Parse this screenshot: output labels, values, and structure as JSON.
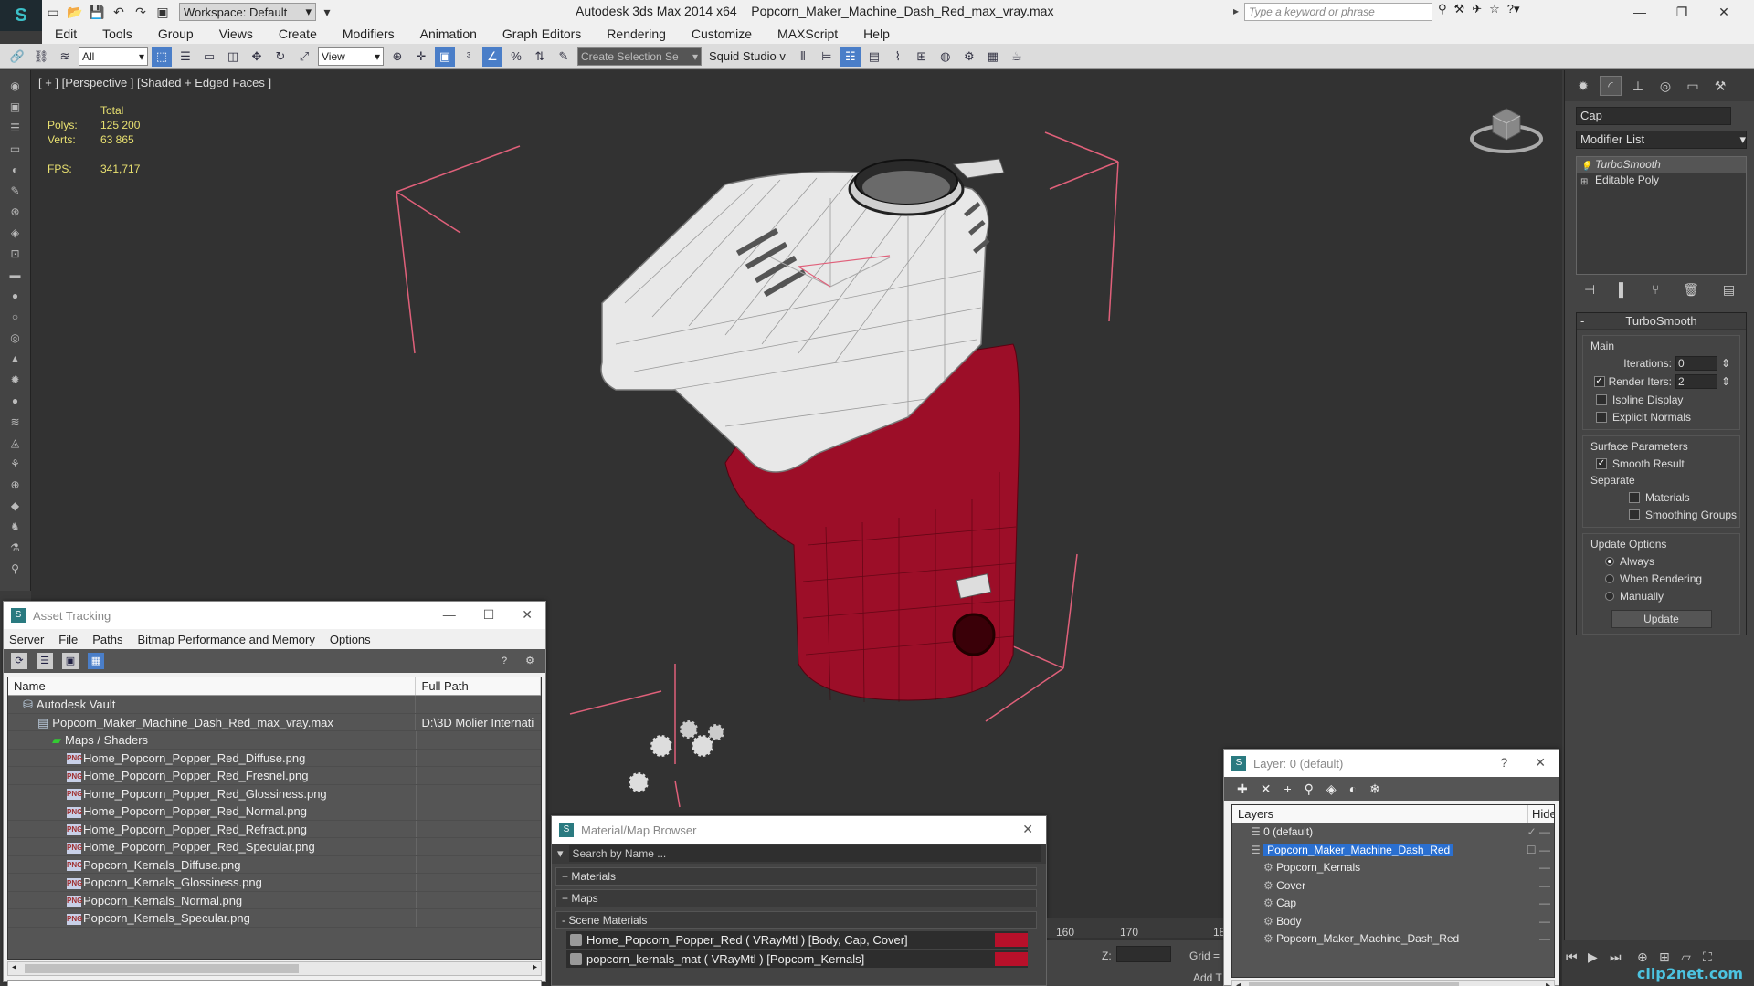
{
  "app": {
    "title": "Autodesk 3ds Max  2014 x64",
    "file": "Popcorn_Maker_Machine_Dash_Red_max_vray.max",
    "workspace": "Workspace: Default",
    "search_placeholder": "Type a keyword or phrase"
  },
  "menu": [
    "Edit",
    "Tools",
    "Group",
    "Views",
    "Create",
    "Modifiers",
    "Animation",
    "Graph Editors",
    "Rendering",
    "Customize",
    "MAXScript",
    "Help"
  ],
  "toolbar": {
    "filter": "All",
    "ref_coord": "View",
    "selection_set_placeholder": "Create Selection Se",
    "squid": "Squid Studio v"
  },
  "viewport": {
    "label": "[ + ] [Perspective ] [Shaded + Edged Faces ]",
    "stats_header": "Total",
    "polys_label": "Polys:",
    "polys_value": "125 200",
    "verts_label": "Verts:",
    "verts_value": "63 865",
    "fps_label": "FPS:",
    "fps_value": "341,717"
  },
  "command_panel": {
    "object_name": "Cap",
    "modifier_list": "Modifier List",
    "stack": [
      "TurboSmooth",
      "Editable Poly"
    ],
    "turbosmooth": {
      "title": "TurboSmooth",
      "main_label": "Main",
      "iterations_label": "Iterations:",
      "iterations_value": "0",
      "render_iters_label": "Render Iters:",
      "render_iters_value": "2",
      "isoline": "Isoline Display",
      "explicit_normals": "Explicit Normals",
      "surface_params": "Surface Parameters",
      "smooth_result": "Smooth Result",
      "separate": "Separate",
      "materials": "Materials",
      "smoothing_groups": "Smoothing Groups",
      "update_options": "Update Options",
      "always": "Always",
      "when_rendering": "When Rendering",
      "manually": "Manually",
      "update_button": "Update"
    }
  },
  "asset_tracking": {
    "title": "Asset Tracking",
    "menu": [
      "Server",
      "File",
      "Paths",
      "Bitmap Performance and Memory",
      "Options"
    ],
    "col_name": "Name",
    "col_path": "Full Path",
    "rows": [
      {
        "name": "Autodesk Vault",
        "path": "",
        "indent": 1,
        "icon": "vault"
      },
      {
        "name": "Popcorn_Maker_Machine_Dash_Red_max_vray.max",
        "path": "D:\\3D Molier Internati",
        "indent": 2,
        "icon": "max"
      },
      {
        "name": "Maps / Shaders",
        "path": "",
        "indent": 3,
        "icon": "maps"
      },
      {
        "name": "Home_Popcorn_Popper_Red_Diffuse.png",
        "path": "",
        "indent": 4,
        "icon": "png"
      },
      {
        "name": "Home_Popcorn_Popper_Red_Fresnel.png",
        "path": "",
        "indent": 4,
        "icon": "png"
      },
      {
        "name": "Home_Popcorn_Popper_Red_Glossiness.png",
        "path": "",
        "indent": 4,
        "icon": "png"
      },
      {
        "name": "Home_Popcorn_Popper_Red_Normal.png",
        "path": "",
        "indent": 4,
        "icon": "png"
      },
      {
        "name": "Home_Popcorn_Popper_Red_Refract.png",
        "path": "",
        "indent": 4,
        "icon": "png"
      },
      {
        "name": "Home_Popcorn_Popper_Red_Specular.png",
        "path": "",
        "indent": 4,
        "icon": "png"
      },
      {
        "name": "Popcorn_Kernals_Diffuse.png",
        "path": "",
        "indent": 4,
        "icon": "png"
      },
      {
        "name": "Popcorn_Kernals_Glossiness.png",
        "path": "",
        "indent": 4,
        "icon": "png"
      },
      {
        "name": "Popcorn_Kernals_Normal.png",
        "path": "",
        "indent": 4,
        "icon": "png"
      },
      {
        "name": "Popcorn_Kernals_Specular.png",
        "path": "",
        "indent": 4,
        "icon": "png"
      }
    ]
  },
  "material_browser": {
    "title": "Material/Map Browser",
    "search_placeholder": "Search by Name ...",
    "sections": [
      "+ Materials",
      "+ Maps",
      "- Scene Materials"
    ],
    "materials": [
      "Home_Popcorn_Popper_Red  ( VRayMtl )  [Body, Cap, Cover]",
      "popcorn_kernals_mat  ( VRayMtl )  [Popcorn_Kernals]"
    ]
  },
  "layer_window": {
    "title": "Layer: 0 (default)",
    "col_layers": "Layers",
    "col_hide": "Hide",
    "rows": [
      {
        "label": "0 (default)",
        "indent": 1,
        "selected": false
      },
      {
        "label": "Popcorn_Maker_Machine_Dash_Red",
        "indent": 1,
        "selected": true
      },
      {
        "label": "Popcorn_Kernals",
        "indent": 2,
        "selected": false
      },
      {
        "label": "Cover",
        "indent": 2,
        "selected": false
      },
      {
        "label": "Cap",
        "indent": 2,
        "selected": false
      },
      {
        "label": "Body",
        "indent": 2,
        "selected": false
      },
      {
        "label": "Popcorn_Maker_Machine_Dash_Red",
        "indent": 2,
        "selected": false
      }
    ]
  },
  "timeline": {
    "t160": "160",
    "t170": "170",
    "t18": "18",
    "z_label": "Z:",
    "grid_label": "Grid =",
    "add_t": "Add T"
  },
  "watermark": "clip2net.com",
  "colors": {
    "accent": "#2a6fd0",
    "body_red": "#a8102c",
    "stats_yellow": "#e8e070",
    "material_swatch": "#b8102a"
  }
}
